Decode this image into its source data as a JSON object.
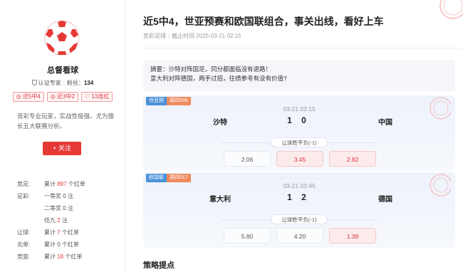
{
  "author": {
    "name": "总督看球",
    "verified_label": "认证专家",
    "fans_label": "粉丝：",
    "fans_count": "134",
    "tags": [
      "近5中4",
      "近3中2",
      "13连红"
    ],
    "description": "竞彩专业玩家，实战性极强，尤为擅长五大联赛分析。",
    "follow_label": "+ 关注"
  },
  "stats": [
    {
      "key": "竞足:",
      "pre": "累计",
      "num": "897",
      "post": "个红单"
    },
    {
      "key": "足彩:",
      "pre": "一等奖",
      "num": "0",
      "post": "注"
    },
    {
      "key": "",
      "pre": "二等奖",
      "num": "0",
      "post": "注"
    },
    {
      "key": "",
      "pre": "任九",
      "num": "2",
      "post": "注"
    },
    {
      "key": "让球:",
      "pre": "累计",
      "num": "7",
      "post": "个红单"
    },
    {
      "key": "北单:",
      "pre": "累计",
      "num": "0",
      "post": "个红单"
    },
    {
      "key": "竞篮:",
      "pre": "累计",
      "num": "18",
      "post": "个红单"
    }
  ],
  "article": {
    "title": "近5中4，世亚预赛和欧国联组合，事关出线，看好上车",
    "source": "竞彩足球",
    "deadline": "截止时间 2025-03-21 02:15",
    "summary_line1": "摘要：沙特对阵国足，同分都面临没有退路！",
    "summary_line2": "意大利对阵德国，两手过招，往绩参考有没有价值?"
  },
  "matches": [
    {
      "league": "世亚预",
      "code": "周四008",
      "time": "03-21 02:15",
      "home": "沙特",
      "score": "1  0",
      "away": "中国",
      "handicap": "让球胜平负(-1)",
      "odds": [
        "2.06",
        "3.45",
        "2.82"
      ],
      "selected": [
        false,
        true,
        true
      ]
    },
    {
      "league": "欧国联",
      "code": "周四017",
      "time": "03-21 03:45",
      "home": "意大利",
      "score": "1  2",
      "away": "德国",
      "handicap": "让球胜平负(-1)",
      "odds": [
        "5.80",
        "4.20",
        "1.39"
      ],
      "selected": [
        false,
        false,
        true
      ]
    }
  ],
  "section_title": "策略提点",
  "colors": {
    "accent": "#e53935",
    "league_badge": "#4a90d9",
    "code_badge": "#f08a5d"
  }
}
